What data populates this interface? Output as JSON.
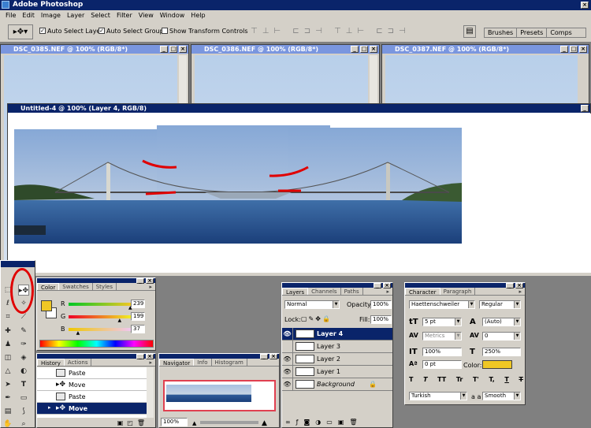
{
  "app": {
    "title": "Adobe Photoshop"
  },
  "menu": [
    "File",
    "Edit",
    "Image",
    "Layer",
    "Select",
    "Filter",
    "View",
    "Window",
    "Help"
  ],
  "options": {
    "auto_select_layer": "Auto Select Layer",
    "auto_select_groups": "Auto Select Groups",
    "show_transform": "Show Transform Controls",
    "palette_tabs": [
      "Brushes",
      "Presets",
      "Comps"
    ]
  },
  "documents": [
    {
      "title": "DSC_0385.NEF @ 100% (RGB/8*)"
    },
    {
      "title": "DSC_0386.NEF @ 100% (RGB/8*)"
    },
    {
      "title": "DSC_0387.NEF @ 100% (RGB/8*)"
    }
  ],
  "main_doc": {
    "title": "Untitled-4 @ 100% (Layer 4, RGB/8)"
  },
  "color_panel": {
    "tabs": [
      "Color",
      "Swatches",
      "Styles"
    ],
    "r_label": "R",
    "g_label": "G",
    "b_label": "B",
    "r": "239",
    "g": "199",
    "b": "37",
    "r_frac": 0.94,
    "g_frac": 0.78,
    "b_frac": 0.15,
    "fg_color": "#efc725"
  },
  "history_panel": {
    "tabs": [
      "History",
      "Actions"
    ],
    "items": [
      "Paste",
      "Move",
      "Paste",
      "Move"
    ],
    "selected": 3
  },
  "navigator_panel": {
    "tabs": [
      "Navigator",
      "Info",
      "Histogram"
    ],
    "zoom": "100%"
  },
  "layers_panel": {
    "tabs": [
      "Layers",
      "Channels",
      "Paths"
    ],
    "blend": "Normal",
    "opacity_label": "Opacity:",
    "opacity": "100%",
    "lock_label": "Lock:",
    "fill_label": "Fill:",
    "fill": "100%",
    "layers": [
      "Layer 4",
      "Layer 3",
      "Layer 2",
      "Layer 1",
      "Background"
    ],
    "selected": 0
  },
  "character_panel": {
    "tabs": [
      "Character",
      "Paragraph"
    ],
    "font": "Haettenschweiler",
    "style": "Regular",
    "size": "5 pt",
    "leading": "(Auto)",
    "kerning": "Metrics",
    "tracking": "0",
    "vscale": "100%",
    "hscale": "250%",
    "baseline": "0 pt",
    "color_label": "Color:",
    "color": "#efc725",
    "style_buttons": [
      "T",
      "T",
      "TT",
      "Tr",
      "T'",
      "T,",
      "T",
      "T"
    ],
    "language": "Turkish",
    "aa_label": "a a",
    "aa": "Smooth"
  },
  "colors": {
    "titlebar": "#0a246a",
    "chrome": "#d4d0c8",
    "annotation": "#e00000"
  }
}
